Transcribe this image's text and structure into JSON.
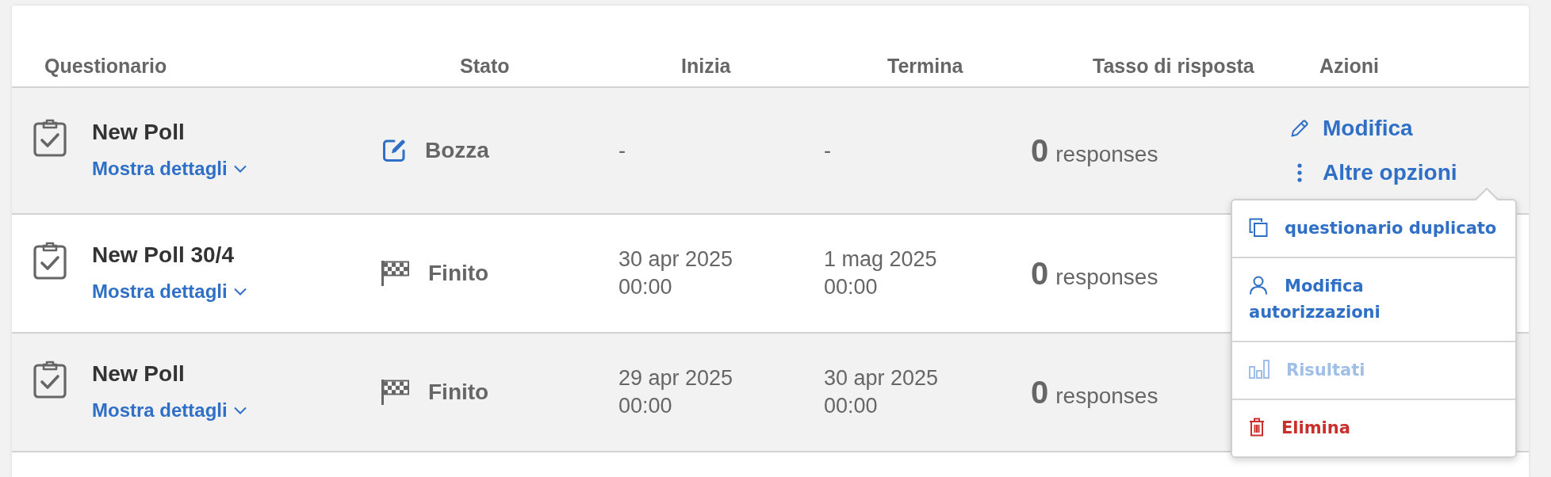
{
  "columns": [
    "Questionario",
    "Stato",
    "Inizia",
    "Termina",
    "Tasso di risposta",
    "Azioni"
  ],
  "rows": [
    {
      "title": "New Poll",
      "details_link": "Mostra dettagli",
      "expanded": false,
      "status": {
        "kind": "draft",
        "label": "Bozza"
      },
      "start": {
        "date": "-"
      },
      "end": {
        "date": "-"
      },
      "responses": {
        "count": "0",
        "label": "responses"
      },
      "actions": [
        {
          "kind": "edit",
          "label": "Modifica"
        },
        {
          "kind": "more",
          "label": "Altre opzioni"
        }
      ]
    },
    {
      "title": "New Poll 30/4",
      "details_link": "Mostra dettagli",
      "expanded": false,
      "status": {
        "kind": "finished",
        "label": "Finito"
      },
      "start": {
        "date": "30 apr 2025",
        "time": "00:00"
      },
      "end": {
        "date": "1 mag 2025",
        "time": "00:00"
      },
      "responses": {
        "count": "0",
        "label": "responses"
      }
    },
    {
      "title": "New Poll",
      "details_link": "Mostra dettagli",
      "expanded": false,
      "status": {
        "kind": "finished",
        "label": "Finito"
      },
      "start": {
        "date": "29 apr 2025",
        "time": "00:00"
      },
      "end": {
        "date": "30 apr 2025",
        "time": "00:00"
      },
      "responses": {
        "count": "0",
        "label": "responses"
      }
    }
  ],
  "options_menu": {
    "items": [
      {
        "kind": "duplicate",
        "label": "questionario duplicato",
        "disabled": false
      },
      {
        "kind": "permissions",
        "label": "Modifica autorizzazioni",
        "disabled": false
      },
      {
        "kind": "results",
        "label": "Risultati",
        "disabled": true
      },
      {
        "kind": "delete",
        "label": "Elimina",
        "disabled": false
      }
    ]
  }
}
